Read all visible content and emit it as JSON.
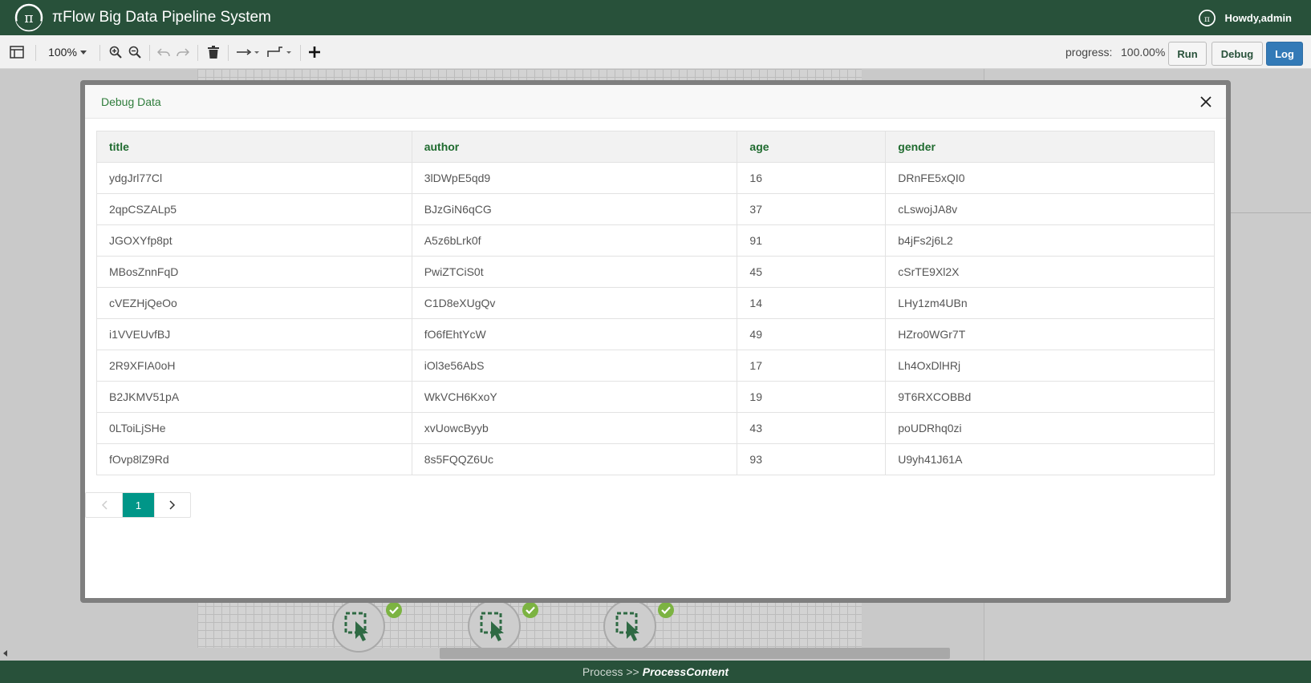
{
  "header": {
    "title": "πFlow Big Data Pipeline System",
    "user_greeting": "Howdy,admin"
  },
  "toolbar": {
    "zoom": "100%",
    "progress_label": "progress:",
    "progress_value": "100.00%",
    "run_label": "Run",
    "debug_label": "Debug",
    "log_label": "Log"
  },
  "modal": {
    "title": "Debug Data",
    "columns": [
      "title",
      "author",
      "age",
      "gender"
    ],
    "rows": [
      [
        "ydgJrl77Cl",
        "3lDWpE5qd9",
        "16",
        "DRnFE5xQI0"
      ],
      [
        "2qpCSZALp5",
        "BJzGiN6qCG",
        "37",
        "cLswojJA8v"
      ],
      [
        "JGOXYfp8pt",
        "A5z6bLrk0f",
        "91",
        "b4jFs2j6L2"
      ],
      [
        "MBosZnnFqD",
        "PwiZTCiS0t",
        "45",
        "cSrTE9Xl2X"
      ],
      [
        "cVEZHjQeOo",
        "C1D8eXUgQv",
        "14",
        "LHy1zm4UBn"
      ],
      [
        "i1VVEUvfBJ",
        "fO6fEhtYcW",
        "49",
        "HZro0WGr7T"
      ],
      [
        "2R9XFIA0oH",
        "iOl3e56AbS",
        "17",
        "Lh4OxDlHRj"
      ],
      [
        "B2JKMV51pA",
        "WkVCH6KxoY",
        "19",
        "9T6RXCOBBd"
      ],
      [
        "0LToiLjSHe",
        "xvUowcByyb",
        "43",
        "poUDRhq0zi"
      ],
      [
        "fOvp8lZ9Rd",
        "8s5FQQZ6Uc",
        "93",
        "U9yh41J61A"
      ]
    ],
    "pagination": {
      "current_page": "1"
    }
  },
  "footer": {
    "prefix": "Process >>",
    "current": "ProcessContent"
  },
  "colors": {
    "brand": "#28513a",
    "accent": "#009688",
    "log_button": "#337ab7",
    "status_ok": "#7cb342"
  }
}
